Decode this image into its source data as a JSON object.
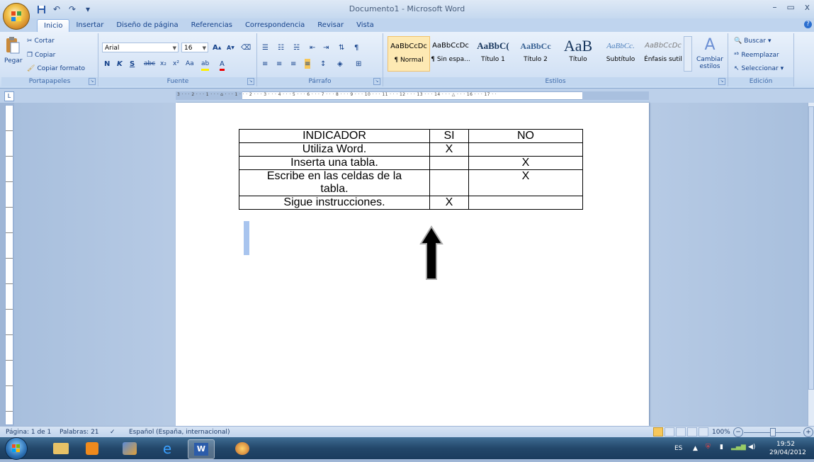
{
  "window": {
    "title": "Documento1 - Microsoft Word",
    "controls": [
      "–",
      "▭",
      "x"
    ]
  },
  "quick_access": {
    "save": "💾",
    "undo": "↶",
    "redo": "↷",
    "more": "▾"
  },
  "tabs": [
    "Inicio",
    "Insertar",
    "Diseño de página",
    "Referencias",
    "Correspondencia",
    "Revisar",
    "Vista"
  ],
  "active_tab": "Inicio",
  "ribbon": {
    "clipboard": {
      "label": "Portapapeles",
      "paste": "Pegar",
      "cut": "Cortar",
      "copy": "Copiar",
      "format_painter": "Copiar formato"
    },
    "font": {
      "label": "Fuente",
      "font_name": "Arial",
      "font_size": "16"
    },
    "paragraph": {
      "label": "Párrafo"
    },
    "styles": {
      "label": "Estilos",
      "items": [
        {
          "sample": "AaBbCcDc",
          "name": "¶ Normal"
        },
        {
          "sample": "AaBbCcDc",
          "name": "¶ Sin espa..."
        },
        {
          "sample": "AaBbC(",
          "name": "Título 1"
        },
        {
          "sample": "AaBbCc",
          "name": "Título 2"
        },
        {
          "sample": "AaB",
          "name": "Título"
        },
        {
          "sample": "AaBbCc.",
          "name": "Subtítulo"
        },
        {
          "sample": "AaBbCcDc",
          "name": "Énfasis sutil"
        }
      ],
      "change": "Cambiar estilos"
    },
    "editing": {
      "label": "Edición",
      "find": "Buscar",
      "replace": "Reemplazar",
      "select": "Seleccionar"
    }
  },
  "ruler": {
    "numbers": "3 · · · 2 · · · 1 · · · ⌂ · · · 1 · · · 2 · · · 3 · · · 4 · · · 5 · · · 6 · · · 7 · · · 8 · · · 9 · · · 10 · · · 11 · · · 12 · · · 13 · · · 14 · · · △ · · · 16 · · · 17 · ·"
  },
  "table": {
    "headers": [
      "INDICADOR",
      "SI",
      "NO"
    ],
    "rows": [
      [
        "Utiliza Word.",
        "X",
        ""
      ],
      [
        "Inserta una tabla.",
        "",
        "X"
      ],
      [
        "Escribe en las celdas de la tabla.",
        "",
        "X"
      ],
      [
        "Sigue instrucciones.",
        "X",
        ""
      ]
    ]
  },
  "status": {
    "page": "Página: 1 de 1",
    "words": "Palabras: 21",
    "language": "Español (España, internacional)",
    "zoom": "100%"
  },
  "tray": {
    "lang": "ES",
    "time": "19:52",
    "date": "29/04/2012"
  }
}
